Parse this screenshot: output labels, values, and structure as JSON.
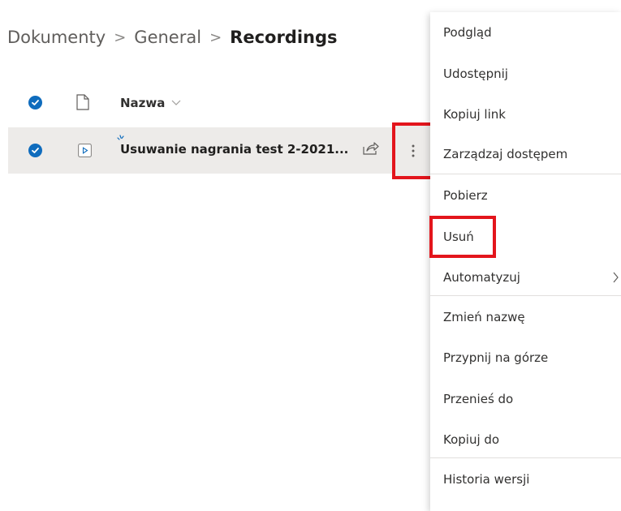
{
  "breadcrumb": {
    "items": [
      "Dokumenty",
      "General"
    ],
    "current": "Recordings",
    "separator": ">"
  },
  "list": {
    "column_name": "Nazwa",
    "rows": [
      {
        "name": "Usuwanie nagrania test 2-2021...",
        "selected": true
      }
    ]
  },
  "context_menu": {
    "items": [
      "Podgląd",
      "Udostępnij",
      "Kopiuj link",
      "Zarządzaj dostępem",
      "Pobierz",
      "Usuń",
      "Automatyzuj",
      "Zmień nazwę",
      "Przypnij na górze",
      "Przenieś do",
      "Kopiuj do",
      "Historia wersji"
    ]
  },
  "colors": {
    "accent": "#0f6cbd",
    "highlight": "#e3151c",
    "row_selected": "#edebe9"
  }
}
